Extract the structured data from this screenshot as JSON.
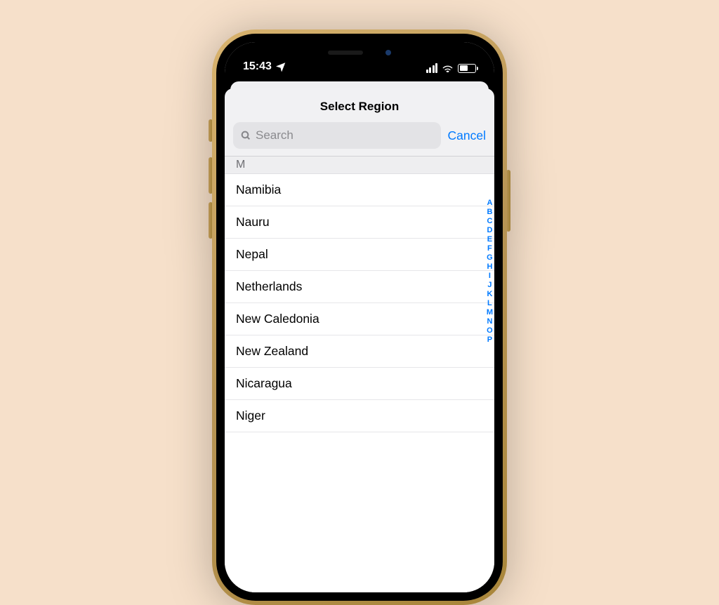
{
  "status": {
    "time": "15:43",
    "battery_pct": 55
  },
  "sheet": {
    "title": "Select Region",
    "search_placeholder": "Search",
    "cancel_label": "Cancel"
  },
  "section_letter": "M",
  "countries": [
    "Namibia",
    "Nauru",
    "Nepal",
    "Netherlands",
    "New Caledonia",
    "New Zealand",
    "Nicaragua",
    "Niger"
  ],
  "index_rail": [
    "A",
    "B",
    "C",
    "D",
    "E",
    "F",
    "G",
    "H",
    "I",
    "J",
    "K",
    "L",
    "M",
    "N",
    "O",
    "P"
  ]
}
